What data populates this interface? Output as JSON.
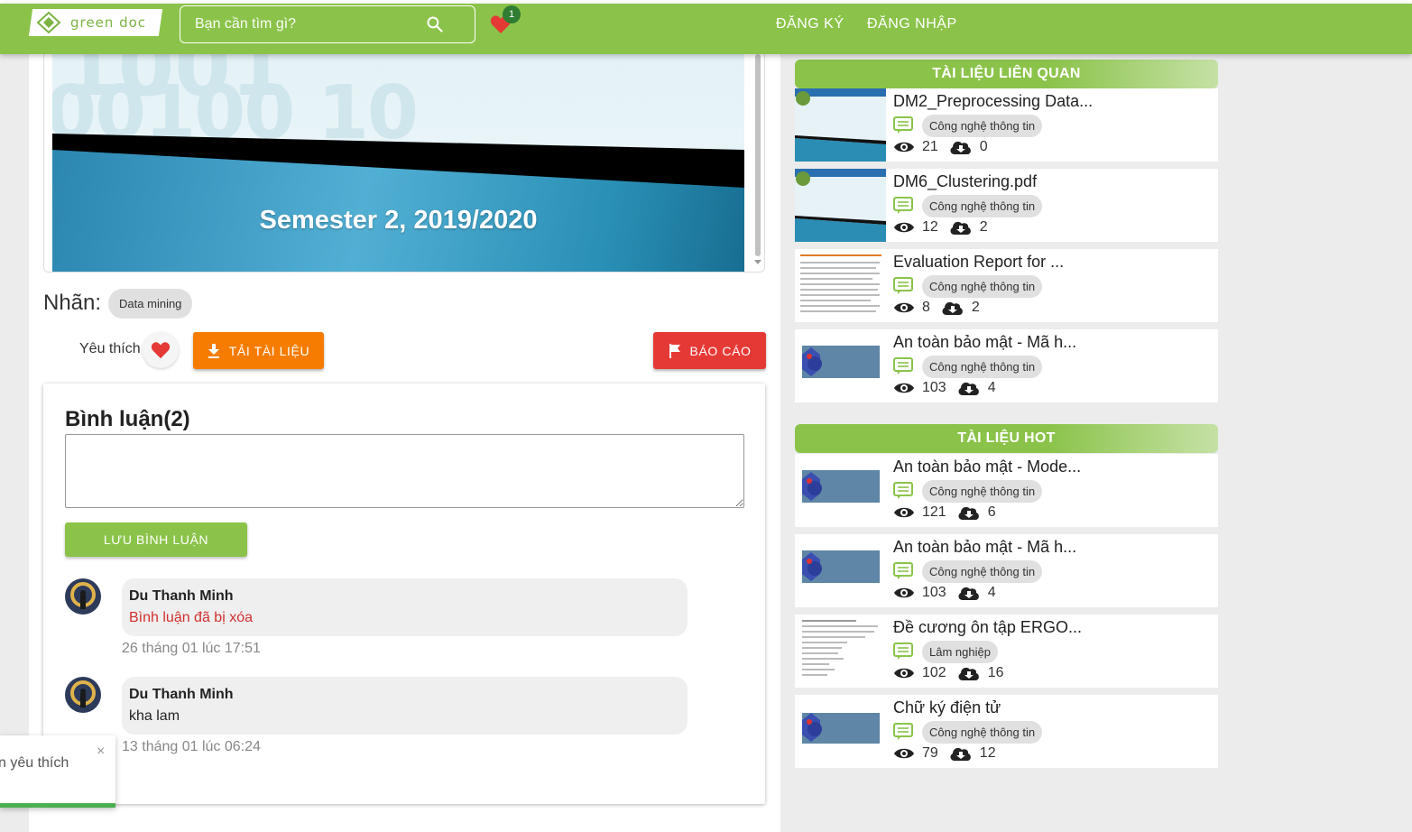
{
  "header": {
    "logo_text": "green doc",
    "search_placeholder": "Bạn cần tìm gì?",
    "favorites_count": "1",
    "register_label": "ĐĂNG KÝ",
    "login_label": "ĐĂNG NHẬP"
  },
  "viewer": {
    "bg_digits_1": "1001",
    "bg_digits_2": "00100 10",
    "slide_text": "Semester 2, 2019/2020"
  },
  "tags": {
    "label": "Nhãn:",
    "items": [
      "Data mining"
    ]
  },
  "actions": {
    "like_label": "Yêu thích",
    "download_label": "TẢI TÀI LIỆU",
    "report_label": "BÁO CÁO"
  },
  "comments": {
    "title": "Bình luận(2)",
    "save_label": "LƯU BÌNH LUẬN",
    "items": [
      {
        "author": "Du Thanh Minh",
        "text": "Bình luận đã bị xóa",
        "time": "26 tháng 01 lúc 17:51"
      },
      {
        "author": "Du Thanh Minh",
        "text": "kha lam",
        "time": "13 tháng 01 lúc 06:24"
      }
    ]
  },
  "toast": {
    "text": "n yêu thích",
    "close": "×"
  },
  "related": {
    "title": "TÀI LIỆU LIÊN QUAN",
    "items": [
      {
        "title": "DM2_Preprocessing Data...",
        "category": "Công nghệ thông tin",
        "views": "21",
        "downloads": "0"
      },
      {
        "title": "DM6_Clustering.pdf",
        "category": "Công nghệ thông tin",
        "views": "12",
        "downloads": "2"
      },
      {
        "title": "Evaluation Report for ...",
        "category": "Công nghệ thông tin",
        "views": "8",
        "downloads": "2"
      },
      {
        "title": "An toàn bảo mật - Mã h...",
        "category": "Công nghệ thông tin",
        "views": "103",
        "downloads": "4"
      }
    ]
  },
  "hot": {
    "title": "TÀI LIỆU HOT",
    "items": [
      {
        "title": "An toàn bảo mật - Mode...",
        "category": "Công nghệ thông tin",
        "views": "121",
        "downloads": "6"
      },
      {
        "title": "An toàn bảo mật - Mã h...",
        "category": "Công nghệ thông tin",
        "views": "103",
        "downloads": "4"
      },
      {
        "title": "Đề cương ôn tập ERGO...",
        "category": "Lâm nghiệp",
        "views": "102",
        "downloads": "16"
      },
      {
        "title": "Chữ ký điện tử",
        "category": "Công nghệ thông tin",
        "views": "79",
        "downloads": "12"
      }
    ]
  },
  "colors": {
    "brand_green": "#8bc34a",
    "download_orange": "#f57c00",
    "report_red": "#e53935",
    "deleted_red": "#d32f2f"
  }
}
